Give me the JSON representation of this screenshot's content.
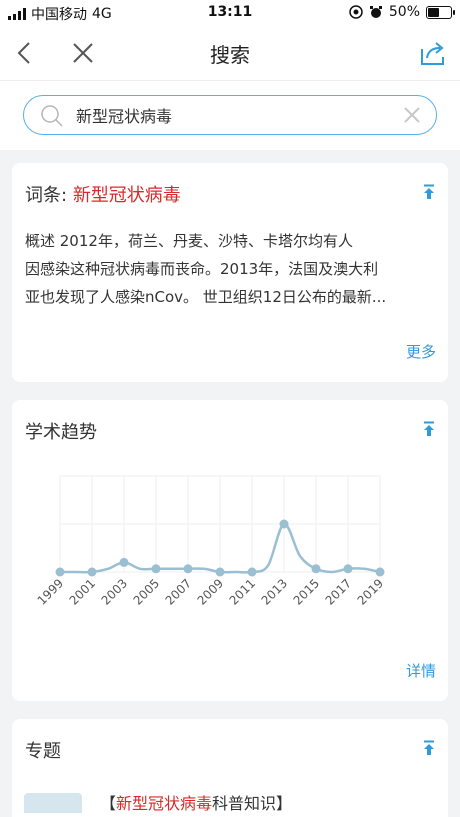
{
  "status_bar": {
    "carrier": "中国移动",
    "network": "4G",
    "time": "13:11",
    "battery": "50%",
    "battery_level": 0.5
  },
  "nav": {
    "title": "搜索",
    "back_icon": "chevron-left-icon",
    "close_icon": "close-icon",
    "share_icon": "share-icon"
  },
  "search": {
    "value": "新型冠状病毒",
    "placeholder": ""
  },
  "entry_card": {
    "label": "词条:",
    "keyword": "新型冠状病毒",
    "lines": [
      "概述        2012年，荷兰、丹麦、沙特、卡塔尔均有人",
      "因感染这种冠状病毒而丧命。2013年，法国及澳大利",
      "亚也发现了人感染nCov。 世卫组织12日公布的最新..."
    ],
    "more_label": "更多"
  },
  "trend_card": {
    "title": "学术趋势",
    "detail_label": "详情"
  },
  "topic_card": {
    "title": "专题",
    "item_prefix": "【",
    "item_keyword": "新型冠状病毒",
    "item_suffix": "科普知识】"
  },
  "chart_data": {
    "type": "line",
    "title": "",
    "xlabel": "",
    "ylabel": "",
    "x": [
      "1999",
      "2000",
      "2001",
      "2002",
      "2003",
      "2004",
      "2005",
      "2006",
      "2007",
      "2008",
      "2009",
      "2010",
      "2011",
      "2012",
      "2013",
      "2014",
      "2015",
      "2016",
      "2017",
      "2018",
      "2019"
    ],
    "series": [
      {
        "values": [
          0,
          0,
          0,
          1,
          3,
          1,
          1,
          1,
          1,
          1,
          0,
          0,
          0,
          2,
          15,
          5,
          1,
          0,
          1,
          1,
          0
        ]
      }
    ],
    "x_ticks": [
      "1999",
      "2001",
      "2003",
      "2005",
      "2007",
      "2009",
      "2011",
      "2013",
      "2015",
      "2017",
      "2019"
    ],
    "ylim": [
      0,
      30
    ],
    "grid": true,
    "colors": {
      "line": "#9bbfd2",
      "point": "#9bbfd2"
    },
    "accent": "#2f9bd9",
    "keyword_color": "#d82a2a"
  }
}
